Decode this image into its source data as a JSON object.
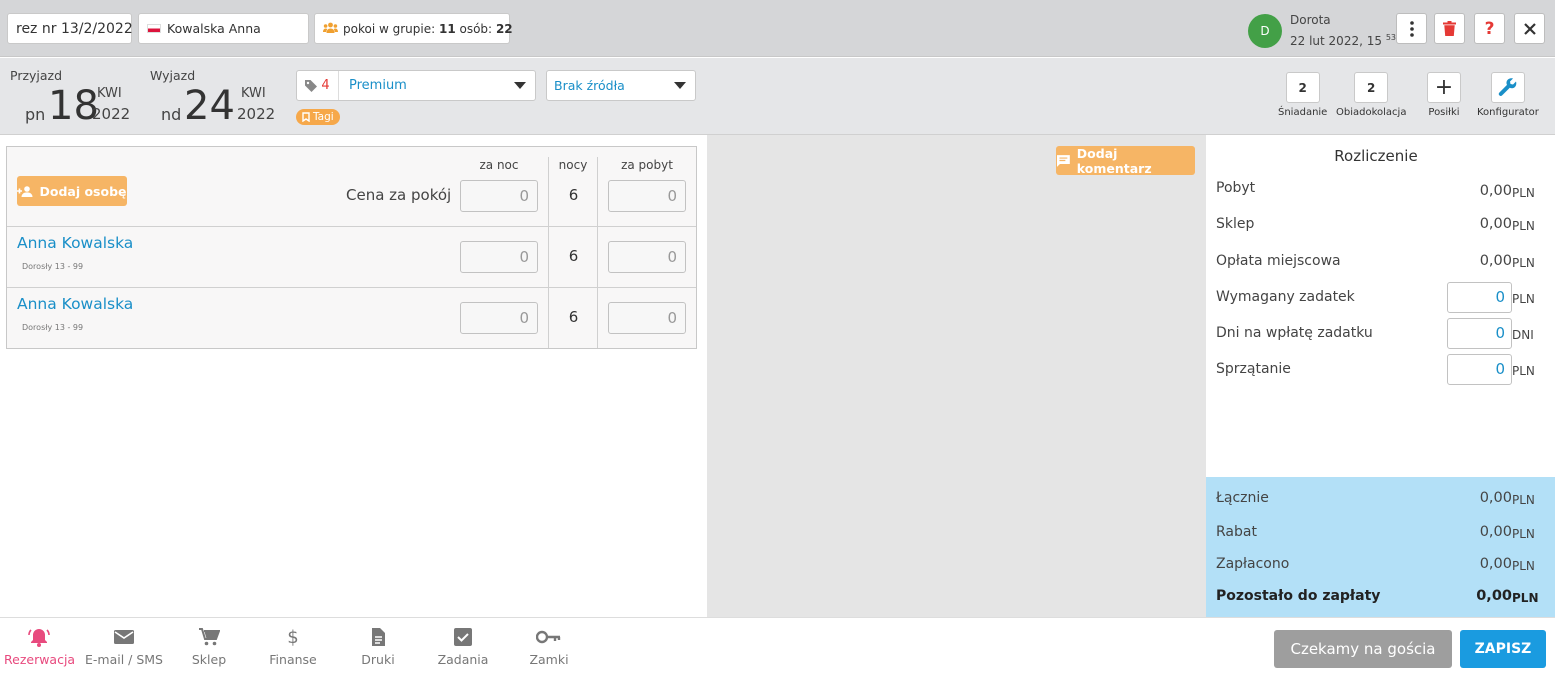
{
  "header": {
    "reservation_label": "rez nr 13/2/2022",
    "guest_name": "Kowalska Anna",
    "group_prefix": "pokoi w grupie:",
    "group_rooms": "11",
    "group_people_label": "osób:",
    "group_people": "22",
    "user_initial": "D",
    "user_name": "Dorota",
    "user_date": "22 lut 2022, 15",
    "user_minutes": "53",
    "help_label": "?"
  },
  "dates": {
    "arrival": {
      "label": "Przyjazd",
      "dow": "pn",
      "day": "18",
      "month": "KWI",
      "year": "2022"
    },
    "departure": {
      "label": "Wyjazd",
      "dow": "nd",
      "day": "24",
      "month": "KWI",
      "year": "2022"
    }
  },
  "room": {
    "number": "4",
    "type": "Premium",
    "source": "Brak źródła",
    "tags_label": "Tagi"
  },
  "meals": [
    {
      "count": "2",
      "label": "Śniadanie"
    },
    {
      "count": "2",
      "label": "Obiadokolacja"
    },
    {
      "count": "+",
      "label": "Posiłki"
    },
    {
      "count": "",
      "label": "Konfigurator"
    }
  ],
  "persons": {
    "add_label": "Dodaj osobę",
    "col_per_night": "za noc",
    "col_nights": "nocy",
    "col_per_stay": "za pobyt",
    "room_price_label": "Cena za pokój",
    "room_price_night": "0",
    "room_nights": "6",
    "room_price_stay": "0",
    "rows": [
      {
        "name": "Anna Kowalska",
        "category": "Dorosły 13 - 99",
        "per_night": "0",
        "nights": "6",
        "per_stay": "0"
      },
      {
        "name": "Anna Kowalska",
        "category": "Dorosły 13 - 99",
        "per_night": "0",
        "nights": "6",
        "per_stay": "0"
      }
    ]
  },
  "comment_label": "Dodaj komentarz",
  "settlement": {
    "title": "Rozliczenie",
    "stay_label": "Pobyt",
    "stay_value": "0,00",
    "shop_label": "Sklep",
    "shop_value": "0,00",
    "fee_label": "Opłata miejscowa",
    "fee_value": "0,00",
    "deposit_label": "Wymagany zadatek",
    "deposit_value": "0",
    "deposit_days_label": "Dni na wpłatę zadatku",
    "deposit_days_value": "0",
    "cleaning_label": "Sprzątanie",
    "cleaning_value": "0",
    "currency": "PLN",
    "days_unit": "DNI",
    "total_label": "Łącznie",
    "total_value": "0,00",
    "discount_label": "Rabat",
    "discount_value": "0,00",
    "paid_label": "Zapłacono",
    "paid_value": "0,00",
    "remaining_label": "Pozostało do zapłaty",
    "remaining_value": "0,00"
  },
  "bottom_nav": [
    {
      "label": "Rezerwacja",
      "icon": "bell-icon"
    },
    {
      "label": "E-mail / SMS",
      "icon": "mail-icon"
    },
    {
      "label": "Sklep",
      "icon": "cart-icon"
    },
    {
      "label": "Finanse",
      "icon": "dollar-icon"
    },
    {
      "label": "Druki",
      "icon": "document-icon"
    },
    {
      "label": "Zadania",
      "icon": "checkbox-icon"
    },
    {
      "label": "Zamki",
      "icon": "key-icon"
    }
  ],
  "actions": {
    "waiting_label": "Czekamy na gościa",
    "save_label": "ZAPISZ"
  },
  "colors": {
    "accent": "#1a9be0",
    "orange": "#f6b565",
    "summary_bg": "#b3e0f7",
    "active_nav": "#e84a7e"
  }
}
